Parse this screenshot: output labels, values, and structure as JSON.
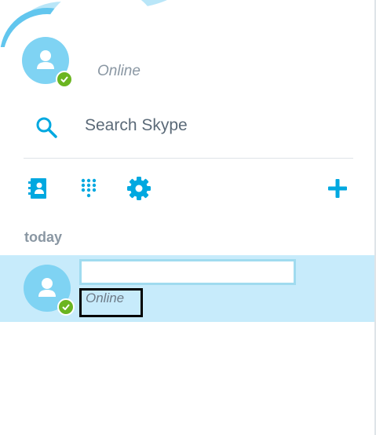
{
  "profile": {
    "status": "Online"
  },
  "search": {
    "label": "Search Skype"
  },
  "toolbar": {
    "icons": [
      "contacts-icon",
      "dialpad-icon",
      "settings-icon",
      "add-icon"
    ]
  },
  "recent": {
    "section_label": "today",
    "items": [
      {
        "name": "",
        "status": "Online"
      }
    ]
  },
  "colors": {
    "accent": "#00a8e0",
    "presence_online": "#6bb521",
    "avatar_bg": "#7fd3f3",
    "selected_row": "#c7ebfb"
  }
}
